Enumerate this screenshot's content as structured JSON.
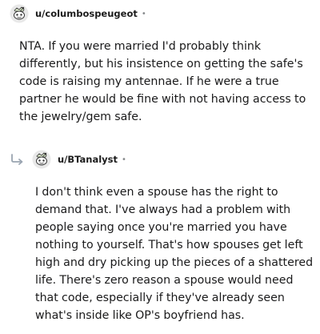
{
  "comments": [
    {
      "username": "u/columbospeugeot",
      "separator": "•",
      "avatar_icon": "snoo-avatar-icon",
      "body": "NTA. If you were married I'd probably think\ndifferently, but his insistence on getting the safe's\ncode is raising my antennae. If he were a true\npartner he would be fine with not having access to\nthe jewelry/gem safe."
    },
    {
      "username": "u/BTanalyst",
      "separator": "•",
      "avatar_icon": "snoo-avatar-icon",
      "reply_icon": "reply-arrow-icon",
      "body": "I don't think even a spouse has the right to\ndemand that. I've always had a problem with\npeople saying once you're married you have\nnothing to yourself. That's how spouses get left\nhigh and dry picking up the pieces of a shattered\nlife. There's zero reason a spouse would need\nthat code, especially if they've already seen\nwhat's inside like OP's boyfriend has."
    }
  ]
}
